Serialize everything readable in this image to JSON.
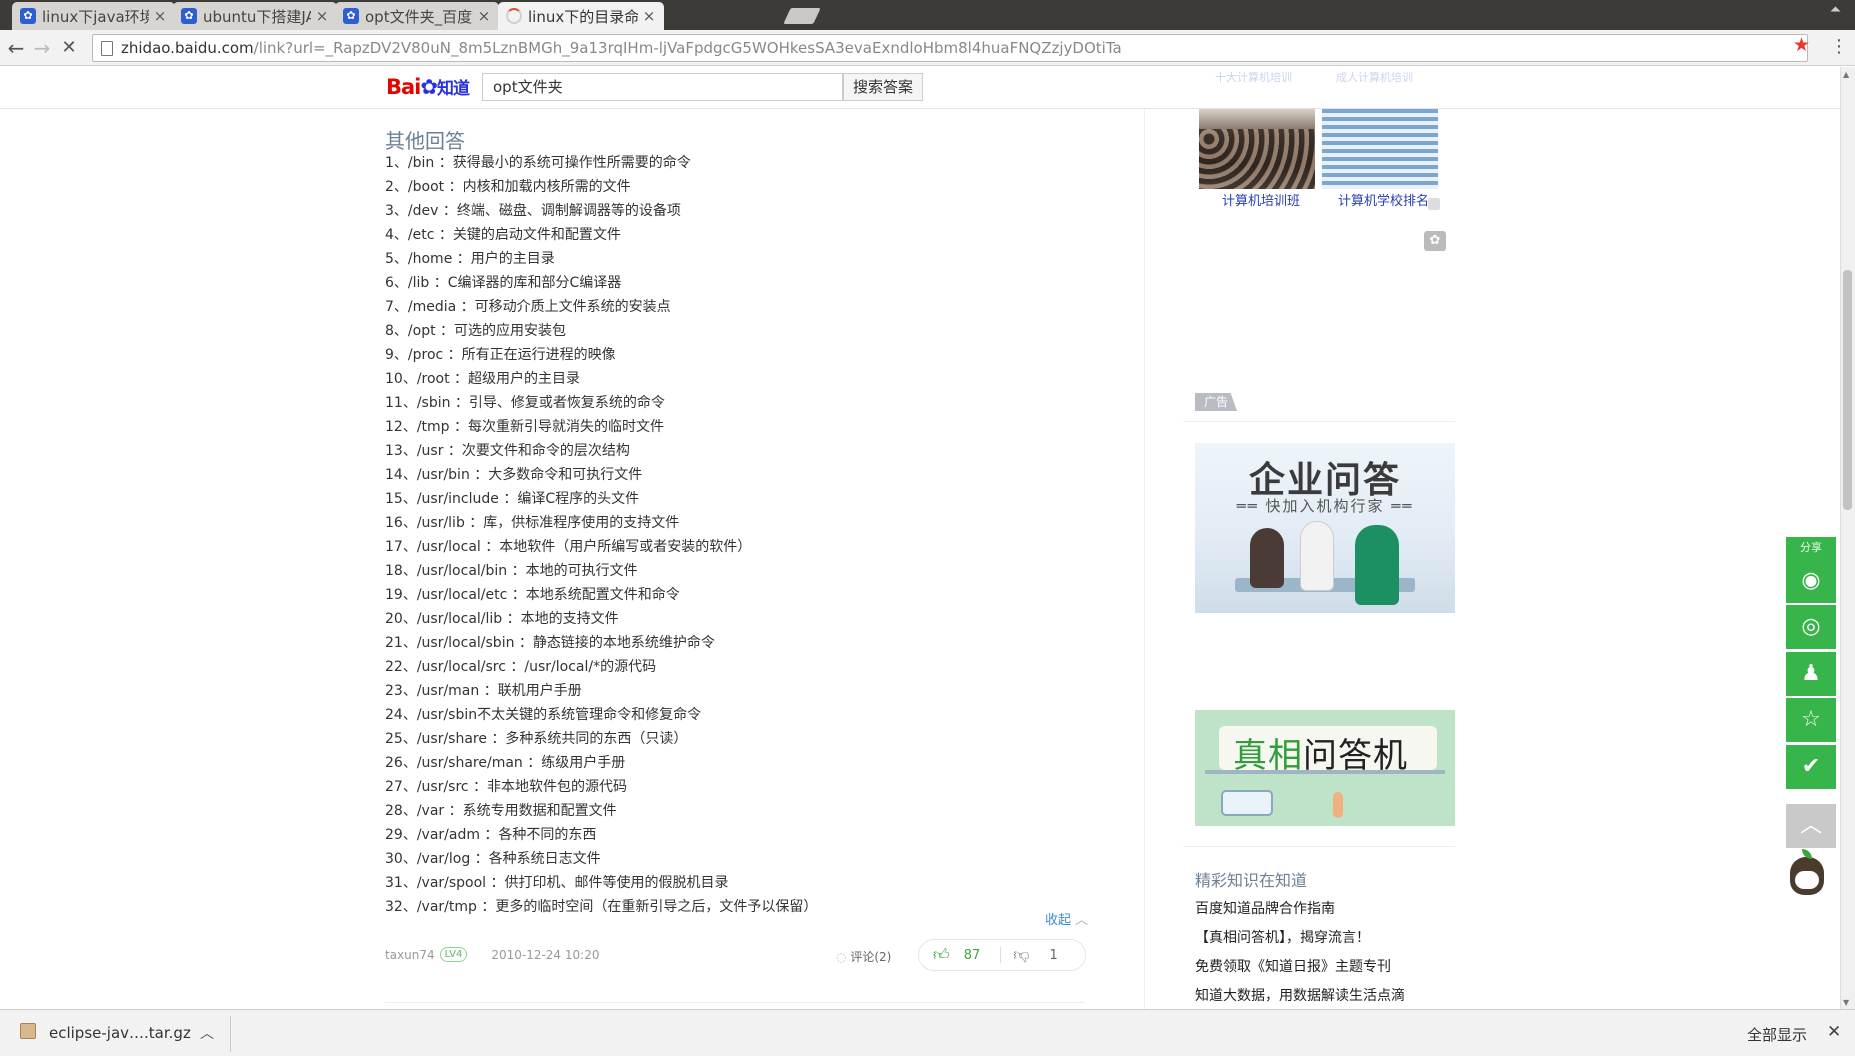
{
  "browser": {
    "tabs": [
      {
        "title": "linux下java环境搭建",
        "active": false,
        "icon": "baidu-paw-icon"
      },
      {
        "title": "ubuntu下搭建JAVA",
        "active": false,
        "icon": "baidu-paw-icon"
      },
      {
        "title": "opt文件夹_百度搜索",
        "active": false,
        "icon": "baidu-paw-icon"
      },
      {
        "title": "linux下的目录命名规",
        "active": true,
        "icon": "loading-spinner-icon"
      }
    ],
    "url_host": "zhidao.baidu.com",
    "url_path": "/link?url=_RapzDV2V80uN_8m5LznBMGh_9a13rqIHm-ljVaFpdgcG5WOHkesSA3evaExndloHbm8l4huaFNQZzjyDOtiTa",
    "star_color": "#e33a2e"
  },
  "site": {
    "logo_bai": "Bai",
    "logo_du": "du",
    "logo_zhidao": "知道",
    "search_query": "opt文件夹",
    "search_button": "搜索答案"
  },
  "answer": {
    "section_title": "其他回答",
    "lines": [
      "1、/bin ：获得最小的系统可操作性所需要的命令",
      "2、/boot ：内核和加载内核所需的文件",
      "3、/dev ：终端、磁盘、调制解调器等的设备项",
      "4、/etc ：关键的启动文件和配置文件",
      "5、/home ：用户的主目录",
      "6、/lib ：C编译器的库和部分C编译器",
      "7、/media ：可移动介质上文件系统的安装点",
      "8、/opt ：可选的应用安装包",
      "9、/proc ：所有正在运行进程的映像",
      "10、/root ：超级用户的主目录",
      "11、/sbin ：引导、修复或者恢复系统的命令",
      "12、/tmp ：每次重新引导就消失的临时文件",
      "13、/usr ：次要文件和命令的层次结构",
      "14、/usr/bin ：大多数命令和可执行文件",
      "15、/usr/include ：编译C程序的头文件",
      "16、/usr/lib ：库，供标准程序使用的支持文件",
      "17、/usr/local ：本地软件（用户所编写或者安装的软件）",
      "18、/usr/local/bin ：本地的可执行文件",
      "19、/usr/local/etc ：本地系统配置文件和命令",
      "20、/usr/local/lib ：本地的支持文件",
      "21、/usr/local/sbin ：静态链接的本地系统维护命令",
      "22、/usr/local/src ：/usr/local/*的源代码",
      "23、/usr/man ：联机用户手册",
      "24、/usr/sbin不太关键的系统管理命令和修复命令",
      "25、/usr/share ：多种系统共同的东西（只读）",
      "26、/usr/share/man ：练级用户手册",
      "27、/usr/src ：非本地软件包的源代码",
      "28、/var ：系统专用数据和配置文件",
      "29、/var/adm ：各种不同的东西",
      "30、/var/log ：各种系统日志文件",
      "31、/var/spool ：供打印机、邮件等使用的假脱机目录",
      "32、/var/tmp ：更多的临时空间（在重新引导之后，文件予以保留）"
    ],
    "collapse_label": "收起",
    "author": "taxun74",
    "level": "LV4",
    "time": "2010-12-24 10:20",
    "comment_label": "评论(2)",
    "upvotes": "87",
    "downvotes": "1"
  },
  "sidebar": {
    "thumb_captions": [
      "计算机培训班",
      "计算机学校排名"
    ],
    "ghost_captions": [
      "十大计算机培训",
      "成人计算机培训"
    ],
    "ad_tag": "广告",
    "banner1_title": "企业问答",
    "banner1_sub": "快加入机构行家",
    "banner2_title_a": "真相",
    "banner2_title_b": "问答机",
    "knowledge_title": "精彩知识在知道",
    "knowledge_items": [
      "百度知道品牌合作指南",
      "【真相问答机】，揭穿流言！",
      "免费领取《知道日报》主题专刊",
      "知道大数据，用数据解读生活点滴"
    ]
  },
  "share": {
    "label": "分享",
    "buttons": [
      "wechat-icon",
      "weibo-icon",
      "qq-icon",
      "favorite-star-icon",
      "clipboard-check-icon",
      "back-to-top-icon"
    ],
    "color": "#37b54a"
  },
  "download": {
    "filename": "eclipse-jav….tar.gz",
    "show_all": "全部显示"
  }
}
